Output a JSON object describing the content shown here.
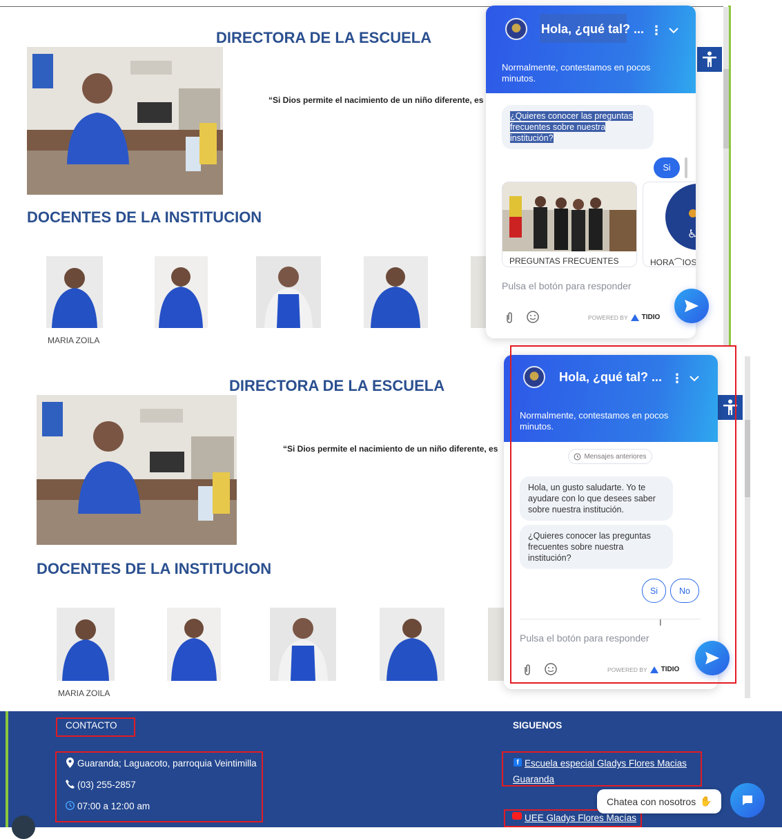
{
  "panels": [
    {
      "heading_director": "DIRECTORA DE LA ESCUELA",
      "quote": "“Si Dios permite el nacimiento de un niño diferente, es",
      "heading_teachers": "DOCENTES DE LA INSTITUCION",
      "teacher_name": "MARIA ZOILA",
      "chat": {
        "title": "Hola, ¿qué tal? ...",
        "subtitle": "Normalmente, contestamos en pocos minutos.",
        "question": "¿Quieres conocer las preguntas frecuentes sobre nuestra institución?",
        "reply": "Si",
        "card1_label": "PREGUNTAS FRECUENTES",
        "card2_label": "HORA⌒IOS",
        "input_placeholder": "Pulsa el botón para responder",
        "powered_by": "POWERED BY",
        "brand": "TIDIO"
      }
    },
    {
      "heading_director": "DIRECTORA DE LA ESCUELA",
      "quote": "“Si Dios permite el nacimiento de un niño diferente, es",
      "heading_teachers": "DOCENTES DE LA INSTITUCION",
      "teacher_name": "MARIA ZOILA",
      "chat": {
        "title": "Hola, ¿qué tal? ...",
        "subtitle": "Normalmente, contestamos en pocos minutos.",
        "previous_messages": "Mensajes anteriores",
        "greeting": "Hola, un gusto saludarte. Yo te ayudare con lo que desees saber sobre nuestra institución.",
        "question": "¿Quieres conocer las preguntas frecuentes sobre nuestra institución?",
        "option_yes": "Si",
        "option_no": "No",
        "input_placeholder": "Pulsa el botón para responder",
        "powered_by": "POWERED BY",
        "brand": "TIDIO"
      }
    }
  ],
  "footer": {
    "contact_heading": "CONTACTO",
    "address": "Guaranda; Laguacoto, parroquia Veintimilla",
    "phone": "(03) 255-2857",
    "hours": "07:00 a 12:00 am",
    "follow_heading": "SIGUENOS",
    "facebook_line1": "Escuela especial Gladys Flores Macias",
    "facebook_line2": "Guaranda",
    "youtube": "UEE Gladys Flores Macías",
    "chat_launcher": "Chatea con nosotros"
  },
  "colors": {
    "heading_blue": "#2a4f8f",
    "footer_bg": "#24478f",
    "chat_gradient_start": "#2e58e8",
    "chat_gradient_end": "#2fa8ef",
    "annotation_red": "#e31b23",
    "accent_green": "#8cc63f"
  }
}
